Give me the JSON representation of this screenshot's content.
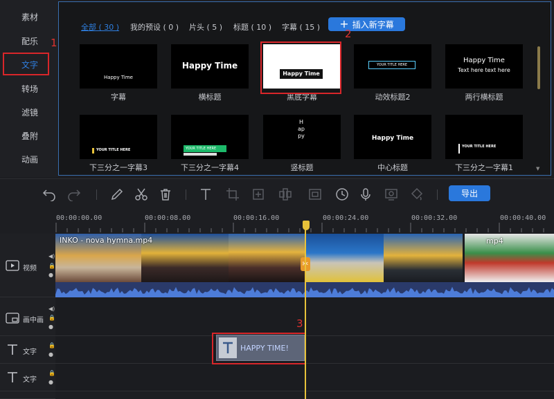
{
  "sidebar": {
    "items": [
      {
        "label": "素材"
      },
      {
        "label": "配乐"
      },
      {
        "label": "文字"
      },
      {
        "label": "转场"
      },
      {
        "label": "滤镜"
      },
      {
        "label": "叠附"
      },
      {
        "label": "动画"
      }
    ]
  },
  "tabs": [
    {
      "label": "全部 ( 30 )"
    },
    {
      "label": "我的预设 ( 0 )"
    },
    {
      "label": "片头 ( 5 )"
    },
    {
      "label": "标题 ( 10 )"
    },
    {
      "label": "字幕 ( 15 )"
    }
  ],
  "insert_button": {
    "label": "插入新字幕"
  },
  "templates": [
    {
      "label": "字幕",
      "preview": "Happy Time"
    },
    {
      "label": "横标题",
      "preview": "Happy Time"
    },
    {
      "label": "黑底字幕",
      "preview": "Happy Time"
    },
    {
      "label": "动效标题2",
      "preview": "YOUR TITLE HERE"
    },
    {
      "label": "两行横标题",
      "preview": "Happy Time",
      "preview2": "Text here text here"
    },
    {
      "label": "下三分之一字幕3",
      "preview": "YOUR TITLE HERE"
    },
    {
      "label": "下三分之一字幕4",
      "preview": "YOUR TITLE HERE"
    },
    {
      "label": "竖标题",
      "preview": "Happy"
    },
    {
      "label": "中心标题",
      "preview": "Happy Time"
    },
    {
      "label": "下三分之一字幕1",
      "preview": "YOUR TITLE HERE"
    }
  ],
  "annotations": [
    "1",
    "2",
    "3"
  ],
  "toolbar": {
    "export_label": "导出"
  },
  "ruler": {
    "ticks": [
      "00:00:00.00",
      "00:00:08.00",
      "00:00:16.00",
      "00:00:24.00",
      "00:00:32.00",
      "00:00:40.00"
    ]
  },
  "tracks": {
    "video": "视频",
    "pip": "画中画",
    "text1": "文字",
    "text2": "文字"
  },
  "video_clip": {
    "name": "INKO - nova hymna.mp4",
    "name2": "mp4"
  },
  "text_clip": {
    "label": "HAPPY TIME!"
  }
}
